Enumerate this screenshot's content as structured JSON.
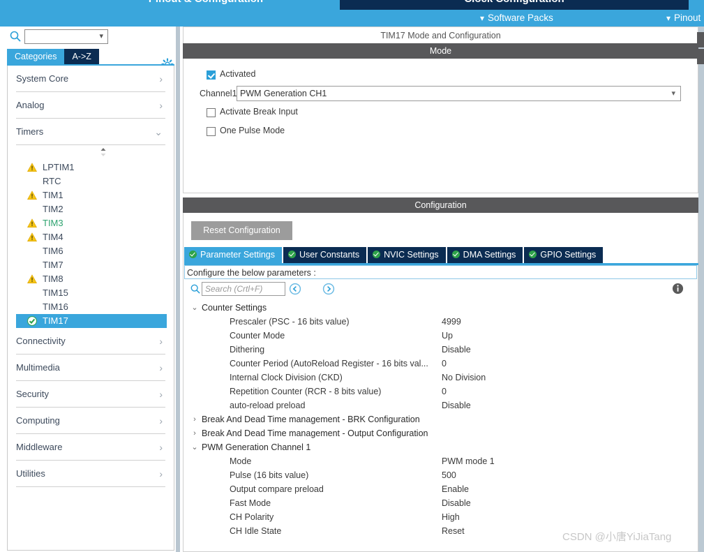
{
  "top_tabs": [
    {
      "label": "Pinout & Configuration",
      "active": true
    },
    {
      "label": "Clock Configuration",
      "active": false
    }
  ],
  "menubar": {
    "software_packs": "Software Packs",
    "pinout": "Pinout"
  },
  "sidebar": {
    "search_value": "",
    "gear_icon": "gear-icon",
    "search_icon": "search-icon",
    "view_tabs": [
      {
        "label": "Categories",
        "active": true
      },
      {
        "label": "A->Z",
        "active": false
      }
    ],
    "categories": [
      {
        "label": "System Core",
        "expanded": false
      },
      {
        "label": "Analog",
        "expanded": false
      },
      {
        "label": "Timers",
        "expanded": true
      },
      {
        "label": "Connectivity",
        "expanded": false
      },
      {
        "label": "Multimedia",
        "expanded": false
      },
      {
        "label": "Security",
        "expanded": false
      },
      {
        "label": "Computing",
        "expanded": false
      },
      {
        "label": "Middleware",
        "expanded": false
      },
      {
        "label": "Utilities",
        "expanded": false
      }
    ],
    "timers": [
      {
        "label": "LPTIM1",
        "icon": "warning-icon",
        "state": "warning"
      },
      {
        "label": "RTC",
        "icon": "",
        "state": "none"
      },
      {
        "label": "TIM1",
        "icon": "warning-icon",
        "state": "warning"
      },
      {
        "label": "TIM2",
        "icon": "",
        "state": "none"
      },
      {
        "label": "TIM3",
        "icon": "warning-icon",
        "state": "warning-green"
      },
      {
        "label": "TIM4",
        "icon": "warning-icon",
        "state": "warning"
      },
      {
        "label": "TIM6",
        "icon": "",
        "state": "none"
      },
      {
        "label": "TIM7",
        "icon": "",
        "state": "none"
      },
      {
        "label": "TIM8",
        "icon": "warning-icon",
        "state": "warning"
      },
      {
        "label": "TIM15",
        "icon": "",
        "state": "none"
      },
      {
        "label": "TIM16",
        "icon": "",
        "state": "none"
      },
      {
        "label": "TIM17",
        "icon": "check-icon",
        "state": "selected"
      }
    ]
  },
  "main": {
    "panel_title": "TIM17 Mode and Configuration",
    "mode": {
      "header": "Mode",
      "activated_label": "Activated",
      "activated_checked": true,
      "channel1_label": "Channel1",
      "channel1_value": "PWM Generation CH1",
      "break_input_label": "Activate Break Input",
      "break_input_checked": false,
      "one_pulse_label": "One Pulse Mode",
      "one_pulse_checked": false
    },
    "configuration": {
      "header": "Configuration",
      "reset_label": "Reset Configuration",
      "tabs": [
        {
          "label": "Parameter Settings",
          "active": true
        },
        {
          "label": "User Constants",
          "active": false
        },
        {
          "label": "NVIC Settings",
          "active": false
        },
        {
          "label": "DMA Settings",
          "active": false
        },
        {
          "label": "GPIO Settings",
          "active": false
        }
      ],
      "note": "Configure the below parameters :",
      "search_placeholder": "Search (Crtl+F)",
      "search_value": "",
      "back_icon": "circle-left-arrow-icon",
      "forward_icon": "circle-right-arrow-icon",
      "info_icon": "info-icon",
      "tree": [
        {
          "type": "group",
          "label": "Counter Settings",
          "expanded": true
        },
        {
          "type": "param",
          "key": "Prescaler (PSC - 16 bits value)",
          "value": "4999"
        },
        {
          "type": "param",
          "key": "Counter Mode",
          "value": "Up"
        },
        {
          "type": "param",
          "key": "Dithering",
          "value": "Disable"
        },
        {
          "type": "param",
          "key": "Counter Period (AutoReload Register - 16 bits val...",
          "value": "0"
        },
        {
          "type": "param",
          "key": "Internal Clock Division (CKD)",
          "value": "No Division"
        },
        {
          "type": "param",
          "key": "Repetition Counter (RCR - 8 bits value)",
          "value": "0"
        },
        {
          "type": "param",
          "key": "auto-reload preload",
          "value": "Disable"
        },
        {
          "type": "group",
          "label": "Break And Dead Time management - BRK Configuration",
          "expanded": false
        },
        {
          "type": "group",
          "label": "Break And Dead Time management - Output Configuration",
          "expanded": false
        },
        {
          "type": "group",
          "label": "PWM Generation Channel 1",
          "expanded": true
        },
        {
          "type": "param",
          "key": "Mode",
          "value": "PWM mode 1"
        },
        {
          "type": "param",
          "key": "Pulse (16 bits value)",
          "value": "500"
        },
        {
          "type": "param",
          "key": "Output compare preload",
          "value": "Enable"
        },
        {
          "type": "param",
          "key": "Fast Mode",
          "value": "Disable"
        },
        {
          "type": "param",
          "key": "CH Polarity",
          "value": "High"
        },
        {
          "type": "param",
          "key": "CH Idle State",
          "value": "Reset"
        }
      ]
    }
  },
  "watermark": "CSDN @小唐YiJiaTang",
  "colors": {
    "accent_blue": "#3aa6dc",
    "dark_navy": "#0b2c52",
    "bar_grey": "#58585a",
    "warning_yellow": "#f5c518",
    "ok_green": "#2ea34a",
    "green_text": "#2ea36f"
  }
}
